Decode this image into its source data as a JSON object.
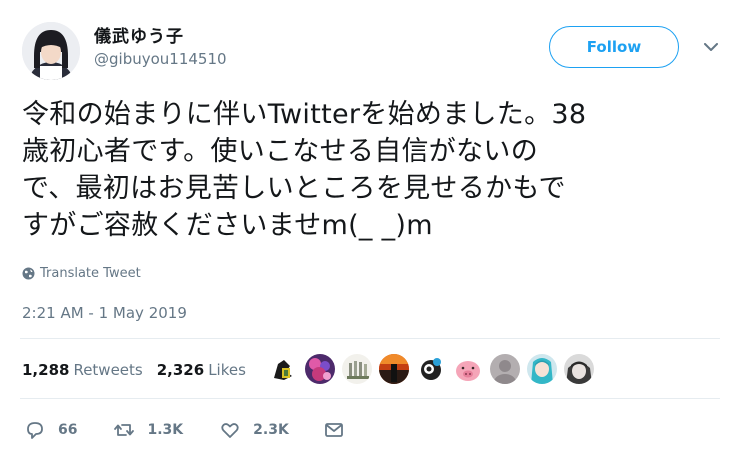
{
  "user": {
    "display_name": "儀武ゆう子",
    "handle": "@gibuyou114510",
    "avatar_icon": "profile-photo"
  },
  "header": {
    "follow_label": "Follow",
    "menu_icon": "chevron-down-icon"
  },
  "tweet": {
    "text": "令和の始まりに伴いTwitterを始めました。38\n歳初心者です。使いこなせる自信がないの\nで、最初はお見苦しいところを見せるかもで\nすがご容赦くださいませm(_ _)m",
    "translate_label": "Translate Tweet",
    "timestamp": "2:21 AM - 1 May 2019"
  },
  "stats": {
    "retweets_count": "1,288",
    "retweets_label": "Retweets",
    "likes_count": "2,326",
    "likes_label": "Likes"
  },
  "actions": {
    "replies": "66",
    "retweets": "1.3K",
    "likes": "2.3K"
  },
  "colors": {
    "accent": "#1da1f2",
    "text": "#14171a",
    "muted": "#657786",
    "divider": "#e6ecf0"
  }
}
